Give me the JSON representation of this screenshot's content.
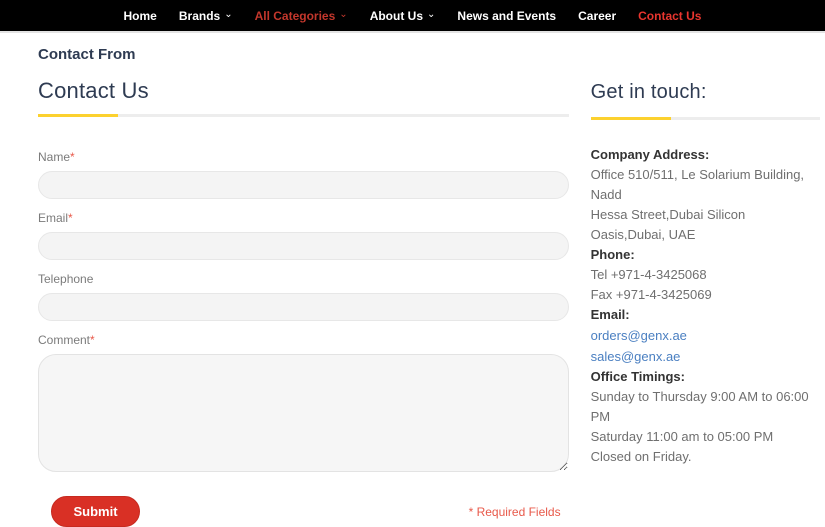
{
  "nav": {
    "chevron": "⌄",
    "items": [
      {
        "label": "Home"
      },
      {
        "label": "Brands",
        "has_dropdown": true
      },
      {
        "label": "All Categories",
        "has_dropdown": true,
        "state": "active"
      },
      {
        "label": "About Us",
        "has_dropdown": true
      },
      {
        "label": "News and Events"
      },
      {
        "label": "Career"
      },
      {
        "label": "Contact Us",
        "state": "highlight"
      }
    ]
  },
  "page": {
    "breadcrumb": "Contact From"
  },
  "form": {
    "title": "Contact Us",
    "fields": [
      {
        "label": "Name",
        "asterisk": "*",
        "value": "",
        "type": "text"
      },
      {
        "label": "Email",
        "asterisk": "*",
        "value": "",
        "type": "text"
      },
      {
        "label": "Telephone",
        "asterisk": "",
        "value": "",
        "type": "text"
      },
      {
        "label": "Comment",
        "asterisk": "*",
        "value": "",
        "type": "textarea"
      }
    ],
    "submit_label": "Submit",
    "required_note": "* Required Fields"
  },
  "contact": {
    "title": "Get in touch:",
    "address": {
      "heading": "Company Address:",
      "lines": [
        "Office 510/511, Le Solarium Building, Nadd",
        "Hessa Street,Dubai Silicon Oasis,Dubai, UAE"
      ]
    },
    "phone": {
      "heading": "Phone:",
      "lines": [
        "Tel +971-4-3425068",
        "Fax +971-4-3425069"
      ]
    },
    "email": {
      "heading": "Email:",
      "links": [
        "orders@genx.ae",
        "sales@genx.ae"
      ]
    },
    "timings": {
      "heading": "Office Timings:",
      "lines": [
        "Sunday to Thursday 9:00 AM to 06:00 PM",
        "Saturday 11:00 am to 05:00 PM",
        "Closed on Friday."
      ]
    }
  },
  "colors": {
    "nav_background": "#000000",
    "nav_active_red": "#c3372c",
    "nav_highlight_red": "#e8352e",
    "accent_yellow": "#fcd12e",
    "heading_navy": "#2e3b52",
    "button_red": "#d93025",
    "link_blue": "#4a7fc1",
    "required_red": "#e8594a",
    "input_background": "#f4f4f4"
  }
}
